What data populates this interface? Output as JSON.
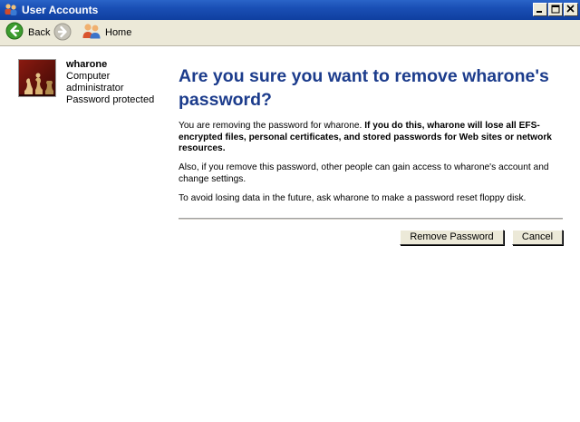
{
  "window": {
    "title": "User Accounts"
  },
  "toolbar": {
    "back_label": "Back",
    "home_label": "Home"
  },
  "user": {
    "name": "wharone",
    "role_line1": "Computer",
    "role_line2": "administrator",
    "status": "Password protected"
  },
  "page": {
    "heading": "Are you sure you want to remove wharone's password?",
    "p1_plain": "You are removing the password for wharone. ",
    "p1_bold": "If you do this, wharone will lose all EFS-encrypted files, personal certificates, and stored passwords for Web sites or network resources.",
    "p2": "Also, if you remove this password, other people can gain access to wharone's account and change settings.",
    "p3": "To avoid losing data in the future, ask wharone to make a password reset floppy disk."
  },
  "buttons": {
    "remove": "Remove Password",
    "cancel": "Cancel"
  },
  "colors": {
    "heading": "#1c3c8c",
    "titlebar": "#1a4fb5",
    "toolbar_bg": "#ece9d8"
  },
  "icons": {
    "back": "back-arrow-icon",
    "forward": "forward-arrow-icon",
    "home": "users-home-icon",
    "avatar": "chess-pieces-picture"
  }
}
